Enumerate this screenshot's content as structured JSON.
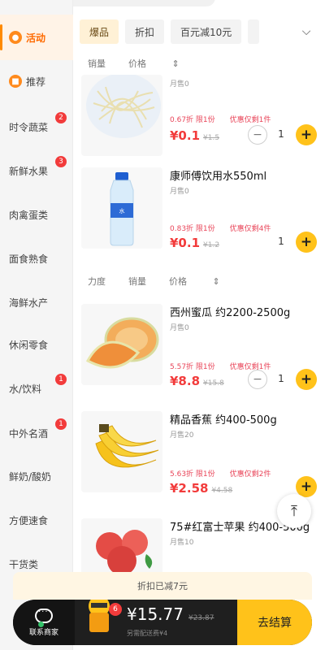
{
  "sidebar": {
    "items": [
      {
        "label": "活动",
        "icon": "activity-icon",
        "active": true,
        "badge": ""
      },
      {
        "label": "推荐",
        "icon": "recommend-icon",
        "active": false,
        "badge": ""
      },
      {
        "label": "时令蔬菜",
        "active": false,
        "badge": "2"
      },
      {
        "label": "新鲜水果",
        "active": false,
        "badge": "3"
      },
      {
        "label": "肉禽蛋类",
        "active": false,
        "badge": ""
      },
      {
        "label": "面食熟食",
        "active": false,
        "badge": ""
      },
      {
        "label": "海鲜水产",
        "active": false,
        "badge": ""
      },
      {
        "label": "休闲零食",
        "active": false,
        "badge": ""
      },
      {
        "label": "水/饮料",
        "active": false,
        "badge": "1"
      },
      {
        "label": "中外名酒",
        "active": false,
        "badge": "1"
      },
      {
        "label": "鲜奶/酸奶",
        "active": false,
        "badge": ""
      },
      {
        "label": "方便速食",
        "active": false,
        "badge": ""
      },
      {
        "label": "干货类",
        "active": false,
        "badge": ""
      }
    ]
  },
  "chips": [
    {
      "label": "爆品",
      "active": true
    },
    {
      "label": "折扣",
      "active": false
    },
    {
      "label": "百元减10元",
      "active": false
    }
  ],
  "sort1": {
    "sales": "销量",
    "price": "价格"
  },
  "sort2": {
    "strength": "力度",
    "sales": "销量",
    "price": "价格"
  },
  "products": [
    {
      "name": "",
      "sold": "月售0",
      "discount": "0.67折 限1份",
      "limit": "优惠仅剩1件",
      "price": "¥0.1",
      "original_price": "¥1.5",
      "quantity": "1"
    },
    {
      "name": "康师傅饮用水550ml",
      "sold": "月售0",
      "discount": "0.83折 限1份",
      "limit": "优惠仅剩4件",
      "price": "¥0.1",
      "original_price": "¥1.2",
      "quantity": "1"
    },
    {
      "name": "西州蜜瓜 约2200-2500g",
      "sold": "月售0",
      "discount": "5.57折 限1份",
      "limit": "优惠仅剩1件",
      "price": "¥8.8",
      "original_price": "¥15.8",
      "quantity": "1"
    },
    {
      "name": "精品香蕉 约400-500g",
      "sold": "月售20",
      "discount": "5.63折 限1份",
      "limit": "优惠仅剩2件",
      "price": "¥2.58",
      "original_price": "¥4.58",
      "quantity": ""
    },
    {
      "name": "75#红富士苹果 约400-500g",
      "sold": "月售10",
      "discount": "",
      "limit": "",
      "price": "",
      "original_price": "",
      "quantity": ""
    }
  ],
  "banner": {
    "text": "折扣已减7元"
  },
  "bottom": {
    "contact_label": "联系商家",
    "cart_count": "6",
    "total": "¥15.77",
    "original_total": "¥23.87",
    "delivery_note": "另需配送费¥4",
    "checkout_label": "去结算"
  },
  "colors": {
    "accent": "#ffc21a",
    "price": "#f23b3b",
    "active": "#ff6a00"
  }
}
